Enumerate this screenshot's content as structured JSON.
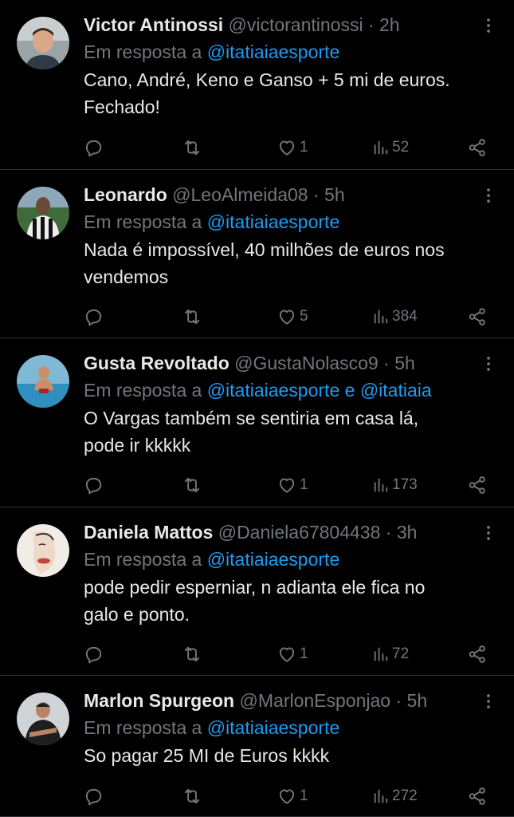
{
  "labels": {
    "reply_prefix": "Em resposta a",
    "and": "e"
  },
  "colors": {
    "background": "#000000",
    "text": "#e7e9ea",
    "muted": "#71767b",
    "link": "#1d9bf0",
    "divider": "#2f3336"
  },
  "tweets": [
    {
      "name": "Victor Antinossi",
      "handle": "@victorantinossi",
      "separator": "·",
      "time": "2h",
      "mentions": [
        "@itatiaiaesporte"
      ],
      "lines": [
        "Cano, André, Keno e Ganso + 5 mi de euros.",
        "Fechado!"
      ],
      "likes": "1",
      "views": "52",
      "avatar": "avatar-man-smiling"
    },
    {
      "name": "Leonardo",
      "handle": "@LeoAlmeida08",
      "separator": "·",
      "time": "5h",
      "mentions": [
        "@itatiaiaesporte"
      ],
      "lines": [
        "Nada é impossível, 40 milhões de euros nos",
        "vendemos"
      ],
      "likes": "5",
      "views": "384",
      "avatar": "avatar-man-striped-jersey"
    },
    {
      "name": "Gusta Revoltado",
      "handle": "@GustaNolasco9",
      "separator": "·",
      "time": "5h",
      "mentions": [
        "@itatiaiaesporte",
        "@itatiaia"
      ],
      "lines": [
        "O Vargas também se sentiria em casa lá,",
        "pode ir kkkkk"
      ],
      "likes": "1",
      "views": "173",
      "avatar": "avatar-man-pool"
    },
    {
      "name": "Daniela Mattos",
      "handle": "@Daniela67804438",
      "separator": "·",
      "time": "3h",
      "mentions": [
        "@itatiaiaesporte"
      ],
      "lines": [
        "pode pedir esperniar, n adianta ele fica no",
        "galo e ponto."
      ],
      "likes": "1",
      "views": "72",
      "avatar": "avatar-illustrated-face"
    },
    {
      "name": "Marlon Spurgeon",
      "handle": "@MarlonEsponjao",
      "separator": "·",
      "time": "5h",
      "mentions": [
        "@itatiaiaesporte"
      ],
      "lines": [
        "So pagar 25 MI de Euros kkkk"
      ],
      "likes": "1",
      "views": "272",
      "avatar": "avatar-man-arms-crossed"
    }
  ]
}
